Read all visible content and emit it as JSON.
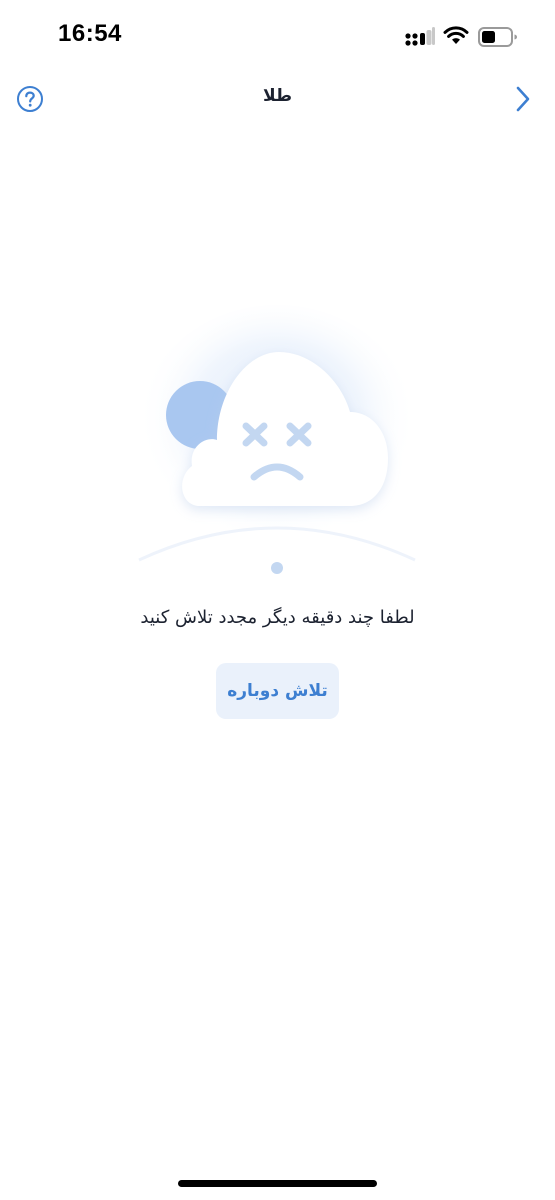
{
  "status_bar": {
    "time": "16:54",
    "icons": [
      "signal-icon",
      "wifi-icon",
      "battery-icon"
    ]
  },
  "nav": {
    "title": "طلا",
    "help_icon": "question-circle-icon",
    "back_icon": "chevron-right-icon"
  },
  "error": {
    "illustration": "sad-cloud-icon",
    "message": "لطفا چند دقیقه دیگر مجدد تلاش کنید",
    "retry_label": "تلاش دوباره"
  },
  "colors": {
    "accent": "#3d7fd1",
    "button_bg": "#eaf1fb",
    "text": "#1c2230",
    "cloud_face": "#c3d7f1",
    "moon": "#a9c7f0"
  }
}
